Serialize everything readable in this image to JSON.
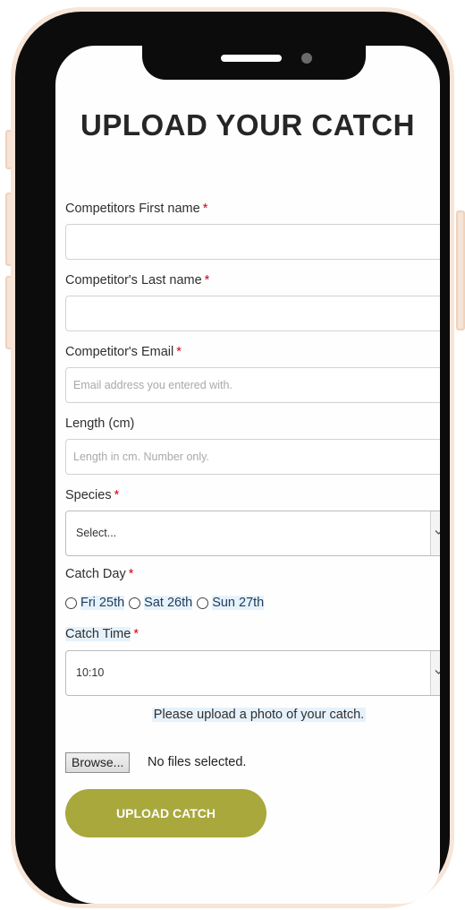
{
  "page": {
    "title": "UPLOAD YOUR CATCH"
  },
  "form": {
    "required_marker": "*",
    "first_name": {
      "label": "Competitors First name",
      "value": "",
      "placeholder": ""
    },
    "last_name": {
      "label": "Competitor's Last name",
      "value": "",
      "placeholder": ""
    },
    "email": {
      "label": "Competitor's Email",
      "value": "",
      "placeholder": "Email address you entered with."
    },
    "length": {
      "label": "Length (cm)",
      "value": "",
      "placeholder": "Length in cm. Number only."
    },
    "species": {
      "label": "Species",
      "selected": "Select..."
    },
    "catch_day": {
      "label": "Catch Day",
      "options": [
        "Fri 25th",
        "Sat 26th",
        "Sun 27th"
      ]
    },
    "catch_time": {
      "label": "Catch Time",
      "selected": "10:10"
    },
    "photo": {
      "instruction": "Please upload a photo of your catch.",
      "browse_label": "Browse...",
      "status": "No files selected."
    },
    "submit_label": "UPLOAD CATCH"
  },
  "colors": {
    "accent": "#a8a83c",
    "required": "#d0001b",
    "phone_frame": "#0c0c0c",
    "phone_ring": "#f7e5d8"
  },
  "icons": {
    "select_arrow": "chevron-down-icon",
    "radio": "radio-button-icon"
  }
}
